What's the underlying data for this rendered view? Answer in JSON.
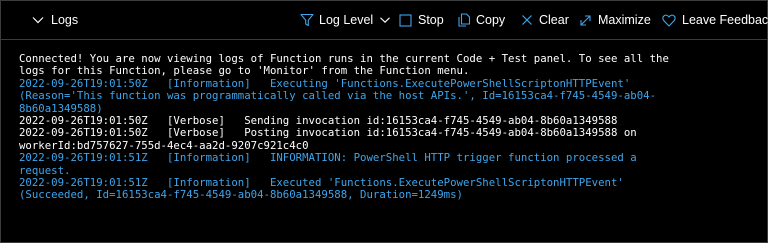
{
  "toolbar": {
    "logs_label": "Logs",
    "log_level_label": "Log Level",
    "stop_label": "Stop",
    "copy_label": "Copy",
    "clear_label": "Clear",
    "maximize_label": "Maximize",
    "feedback_label": "Leave Feedback"
  },
  "colors": {
    "background": "#000000",
    "text": "#ffffff",
    "info": "#3ea5ec",
    "accent": "#3ea5ec"
  },
  "icons": {
    "logs": "chevron-down-icon",
    "log_level": "filter-icon",
    "log_level_dropdown": "chevron-down-icon",
    "stop": "stop-icon",
    "copy": "copy-icon",
    "clear": "close-icon",
    "maximize": "maximize-icon",
    "feedback": "heart-icon"
  },
  "log_lines": [
    {
      "text": "Connected! You are now viewing logs of Function runs in the current Code + Test panel. To see all the",
      "level": "message"
    },
    {
      "text": "logs for this Function, please go to 'Monitor' from the Function menu.",
      "level": "message"
    },
    {
      "text": "2022-09-26T19:01:50Z   [Information]   Executing 'Functions.ExecutePowerShellScriptonHTTPEvent'",
      "level": "information"
    },
    {
      "text": "(Reason='This function was programmatically called via the host APIs.', Id=16153ca4-f745-4549-ab04-",
      "level": "information"
    },
    {
      "text": "8b60a1349588)",
      "level": "information"
    },
    {
      "text": "2022-09-26T19:01:50Z   [Verbose]   Sending invocation id:16153ca4-f745-4549-ab04-8b60a1349588",
      "level": "verbose"
    },
    {
      "text": "2022-09-26T19:01:50Z   [Verbose]   Posting invocation id:16153ca4-f745-4549-ab04-8b60a1349588 on",
      "level": "verbose"
    },
    {
      "text": "workerId:bd757627-755d-4ec4-aa2d-9207c921c4c0",
      "level": "verbose"
    },
    {
      "text": "2022-09-26T19:01:51Z   [Information]   INFORMATION: PowerShell HTTP trigger function processed a",
      "level": "information"
    },
    {
      "text": "request.",
      "level": "information"
    },
    {
      "text": "2022-09-26T19:01:51Z   [Information]   Executed 'Functions.ExecutePowerShellScriptonHTTPEvent'",
      "level": "information"
    },
    {
      "text": "(Succeeded, Id=16153ca4-f745-4549-ab04-8b60a1349588, Duration=1249ms)",
      "level": "information"
    }
  ]
}
